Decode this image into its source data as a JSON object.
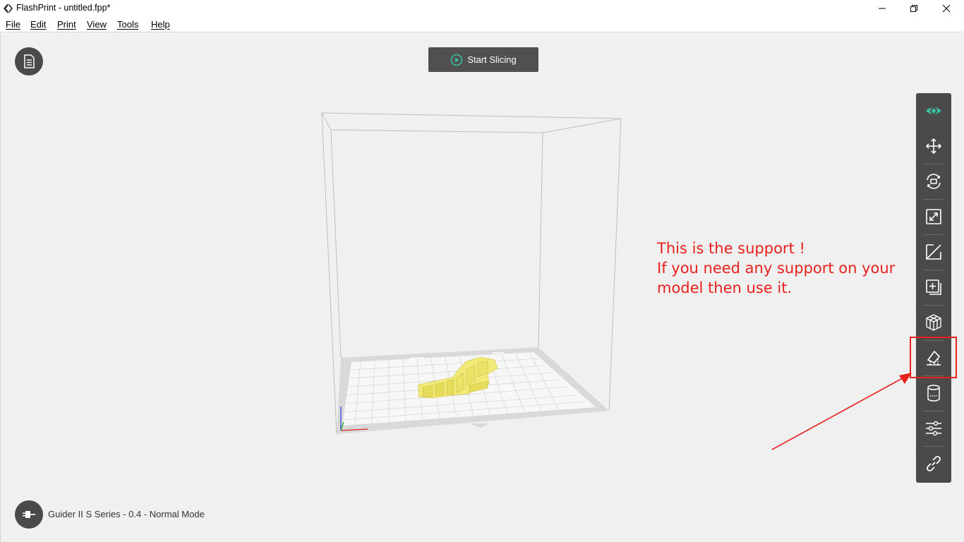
{
  "window": {
    "title": "FlashPrint - untitled.fpp*"
  },
  "menu": {
    "file": "File",
    "edit": "Edit",
    "print": "Print",
    "view": "View",
    "tools": "Tools",
    "help": "Help"
  },
  "header": {
    "start_slicing": "Start Slicing"
  },
  "annotation": {
    "line1": "This is the support !",
    "line2": "If you need any support on your",
    "line3": "model then use it."
  },
  "status": {
    "printer": "Guider II S Series - 0.4 - Normal Mode"
  },
  "colors": {
    "accent": "#3dbfa0",
    "annotation": "#e8211d",
    "model": "#f2ea78",
    "toolbar": "#4a4a4a"
  },
  "toolbar": {
    "tools": [
      "view",
      "move",
      "rotate",
      "scale",
      "cut",
      "extruder",
      "slice-model",
      "supports",
      "cylinder",
      "settings",
      "link"
    ],
    "highlighted": "supports"
  }
}
